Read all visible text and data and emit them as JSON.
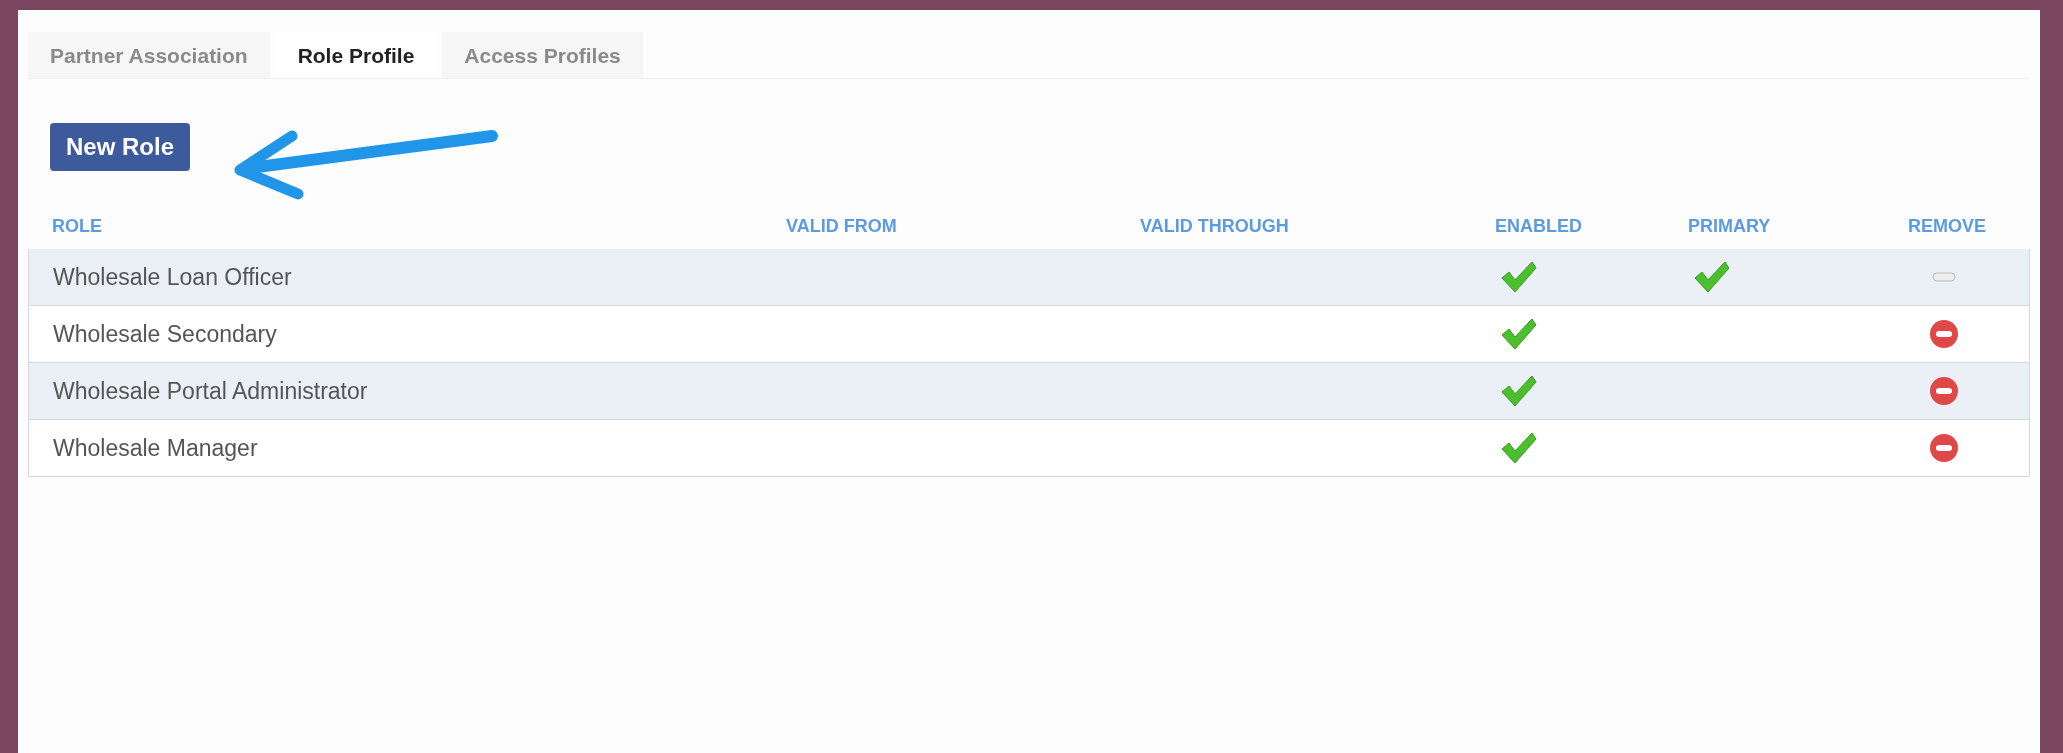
{
  "tabs": [
    {
      "label": "Partner Association",
      "selected": false
    },
    {
      "label": "Role Profile",
      "selected": true
    },
    {
      "label": "Access Profiles",
      "selected": false
    }
  ],
  "new_role_button": "New Role",
  "table": {
    "columns": [
      "ROLE",
      "VALID FROM",
      "VALID THROUGH",
      "ENABLED",
      "PRIMARY",
      "REMOVE"
    ],
    "rows": [
      {
        "role": "Wholesale Loan Officer",
        "enabled": true,
        "primary": true,
        "removable": false
      },
      {
        "role": "Wholesale Secondary",
        "enabled": true,
        "primary": false,
        "removable": true
      },
      {
        "role": "Wholesale Portal Administrator",
        "enabled": true,
        "primary": false,
        "removable": true
      },
      {
        "role": "Wholesale Manager",
        "enabled": true,
        "primary": false,
        "removable": true
      }
    ]
  }
}
